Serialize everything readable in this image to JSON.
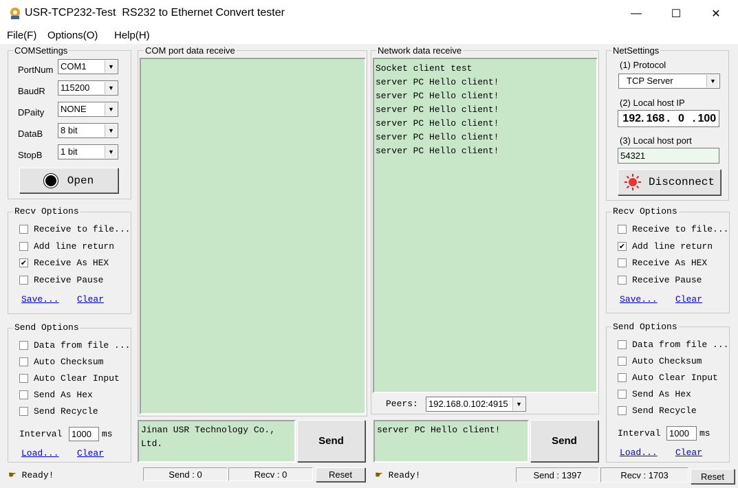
{
  "window": {
    "title": "USR-TCP232-Test  RS232 to Ethernet Convert tester",
    "minimize": "—",
    "maximize": "☐",
    "close": "✕"
  },
  "menu": [
    "File(F)",
    "Options(O)",
    "Help(H)"
  ],
  "com_settings": {
    "title": "COMSettings",
    "fields": [
      {
        "label": "PortNum",
        "value": "COM1"
      },
      {
        "label": "BaudR",
        "value": "115200"
      },
      {
        "label": "DPaity",
        "value": "NONE"
      },
      {
        "label": "DataB",
        "value": "8 bit"
      },
      {
        "label": "StopB",
        "value": "1 bit"
      }
    ],
    "open_label": "Open"
  },
  "left_recv": {
    "title": "Recv Options",
    "options": [
      {
        "label": "Receive to file...",
        "checked": false
      },
      {
        "label": "Add line return",
        "checked": false
      },
      {
        "label": "Receive As HEX",
        "checked": true
      },
      {
        "label": "Receive Pause",
        "checked": false
      }
    ],
    "save": "Save...",
    "clear": "Clear"
  },
  "left_send": {
    "title": "Send Options",
    "options": [
      {
        "label": "Data from file ...",
        "checked": false
      },
      {
        "label": "Auto Checksum",
        "checked": false
      },
      {
        "label": "Auto Clear Input",
        "checked": false
      },
      {
        "label": "Send As Hex",
        "checked": false
      },
      {
        "label": "Send Recycle",
        "checked": false
      }
    ],
    "interval_label": "Interval",
    "interval_value": "1000",
    "interval_unit": "ms",
    "load": "Load...",
    "clear": "Clear"
  },
  "com_receive": {
    "title": "COM port data receive"
  },
  "com_send": {
    "text_line1": "Jinan USR Technology Co.,",
    "text_line2": "Ltd.",
    "send_label": "Send"
  },
  "net_receive": {
    "title": "Network data receive",
    "lines": [
      "Socket client test",
      "server PC Hello client!",
      "server PC Hello client!",
      "server PC Hello client!",
      "server PC Hello client!",
      "server PC Hello client!",
      "server PC Hello client!"
    ],
    "peers_label": "Peers:",
    "peers_value": "192.168.0.102:4915"
  },
  "net_send": {
    "text": "server PC Hello client!",
    "send_label": "Send"
  },
  "net_settings": {
    "title": "NetSettings",
    "protocol_label": "(1) Protocol",
    "protocol_value": "TCP Server",
    "ip_label": "(2) Local host IP",
    "ip": [
      "192",
      "168",
      "0",
      "100"
    ],
    "port_label": "(3) Local host port",
    "port_value": "54321",
    "disconnect_label": "Disconnect"
  },
  "right_recv": {
    "title": "Recv Options",
    "options": [
      {
        "label": "Receive to file...",
        "checked": false
      },
      {
        "label": "Add line return",
        "checked": true
      },
      {
        "label": "Receive As HEX",
        "checked": false
      },
      {
        "label": "Receive Pause",
        "checked": false
      }
    ],
    "save": "Save...",
    "clear": "Clear"
  },
  "right_send": {
    "title": "Send Options",
    "options": [
      {
        "label": "Data from file ...",
        "checked": false
      },
      {
        "label": "Auto Checksum",
        "checked": false
      },
      {
        "label": "Auto Clear Input",
        "checked": false
      },
      {
        "label": "Send As Hex",
        "checked": false
      },
      {
        "label": "Send Recycle",
        "checked": false
      }
    ],
    "interval_label": "Interval",
    "interval_value": "1000",
    "interval_unit": "ms",
    "load": "Load...",
    "clear": "Clear"
  },
  "status_left": {
    "ready": "Ready!",
    "send": "Send : 0",
    "recv": "Recv : 0",
    "reset": "Reset"
  },
  "status_right": {
    "ready": "Ready!",
    "send": "Send : 1397",
    "recv": "Recv : 1703",
    "reset": "Reset"
  },
  "colors": {
    "pane_bg": "#c8e6c8",
    "link": "#0000ee",
    "disconnect_icon": "#e02020"
  }
}
